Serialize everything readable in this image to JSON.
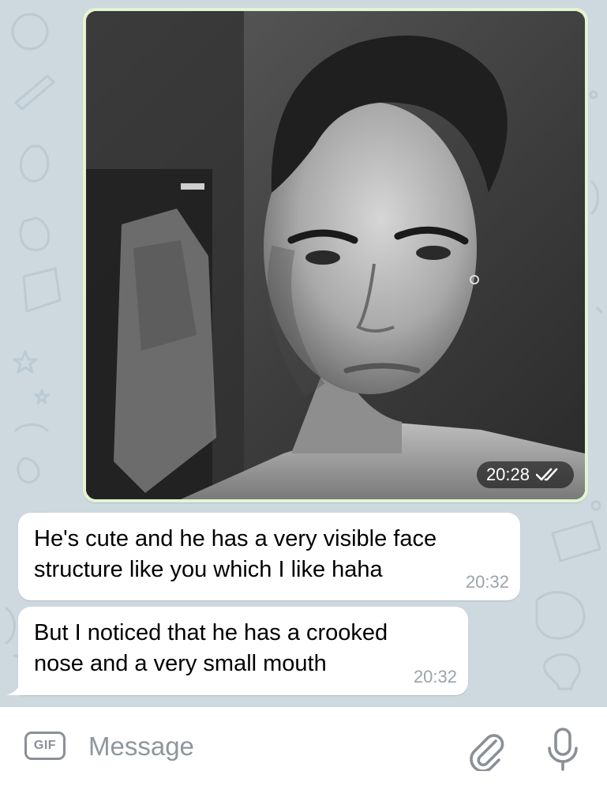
{
  "messages": [
    {
      "type": "photo",
      "direction": "outgoing",
      "time": "20:28",
      "status": "read",
      "status_icon": "double-check-icon",
      "image_description": ""
    },
    {
      "type": "text",
      "direction": "incoming",
      "text": "He's cute and he has a very visible face\nstructure like you which I like haha",
      "time": "20:32"
    },
    {
      "type": "text",
      "direction": "incoming",
      "text": "But I noticed that he has a crooked\nnose and a very small mouth",
      "time": "20:32"
    }
  ],
  "input": {
    "gif_label": "GIF",
    "placeholder": "Message",
    "value": "",
    "attach_icon": "paperclip-icon",
    "mic_icon": "microphone-icon"
  },
  "colors": {
    "wallpaper": "#cdd8df",
    "outgoing_bubble": "#e2f5d2",
    "incoming_bubble": "#ffffff",
    "time_gray": "#9aa3ab",
    "icon_gray": "#8a9096"
  }
}
